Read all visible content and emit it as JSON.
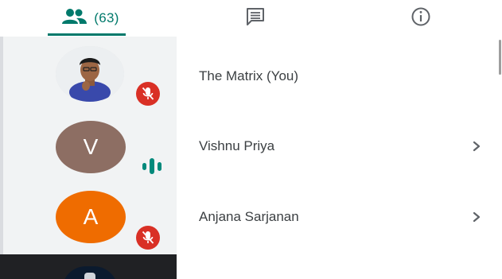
{
  "tabs": {
    "people": {
      "icon": "people-icon",
      "count": "(63)",
      "active": true
    },
    "chat": {
      "icon": "chat-icon"
    },
    "info": {
      "icon": "info-icon"
    }
  },
  "colors": {
    "accent": "#00796b",
    "mute_badge": "#d93025",
    "avatar_v": "#8d6e63",
    "avatar_a": "#ef6c00",
    "left_panel": "#f1f3f4"
  },
  "participants": [
    {
      "name": "The Matrix (You)",
      "avatar_type": "photo",
      "status": "muted",
      "status_icon": "mic-off-icon",
      "chevron": false
    },
    {
      "name": "Vishnu Priya",
      "initial": "V",
      "status": "speaking",
      "status_icon": "speaking-icon",
      "chevron": true
    },
    {
      "name": "Anjana Sarjanan",
      "initial": "A",
      "status": "muted",
      "status_icon": "mic-off-icon",
      "chevron": true
    }
  ]
}
